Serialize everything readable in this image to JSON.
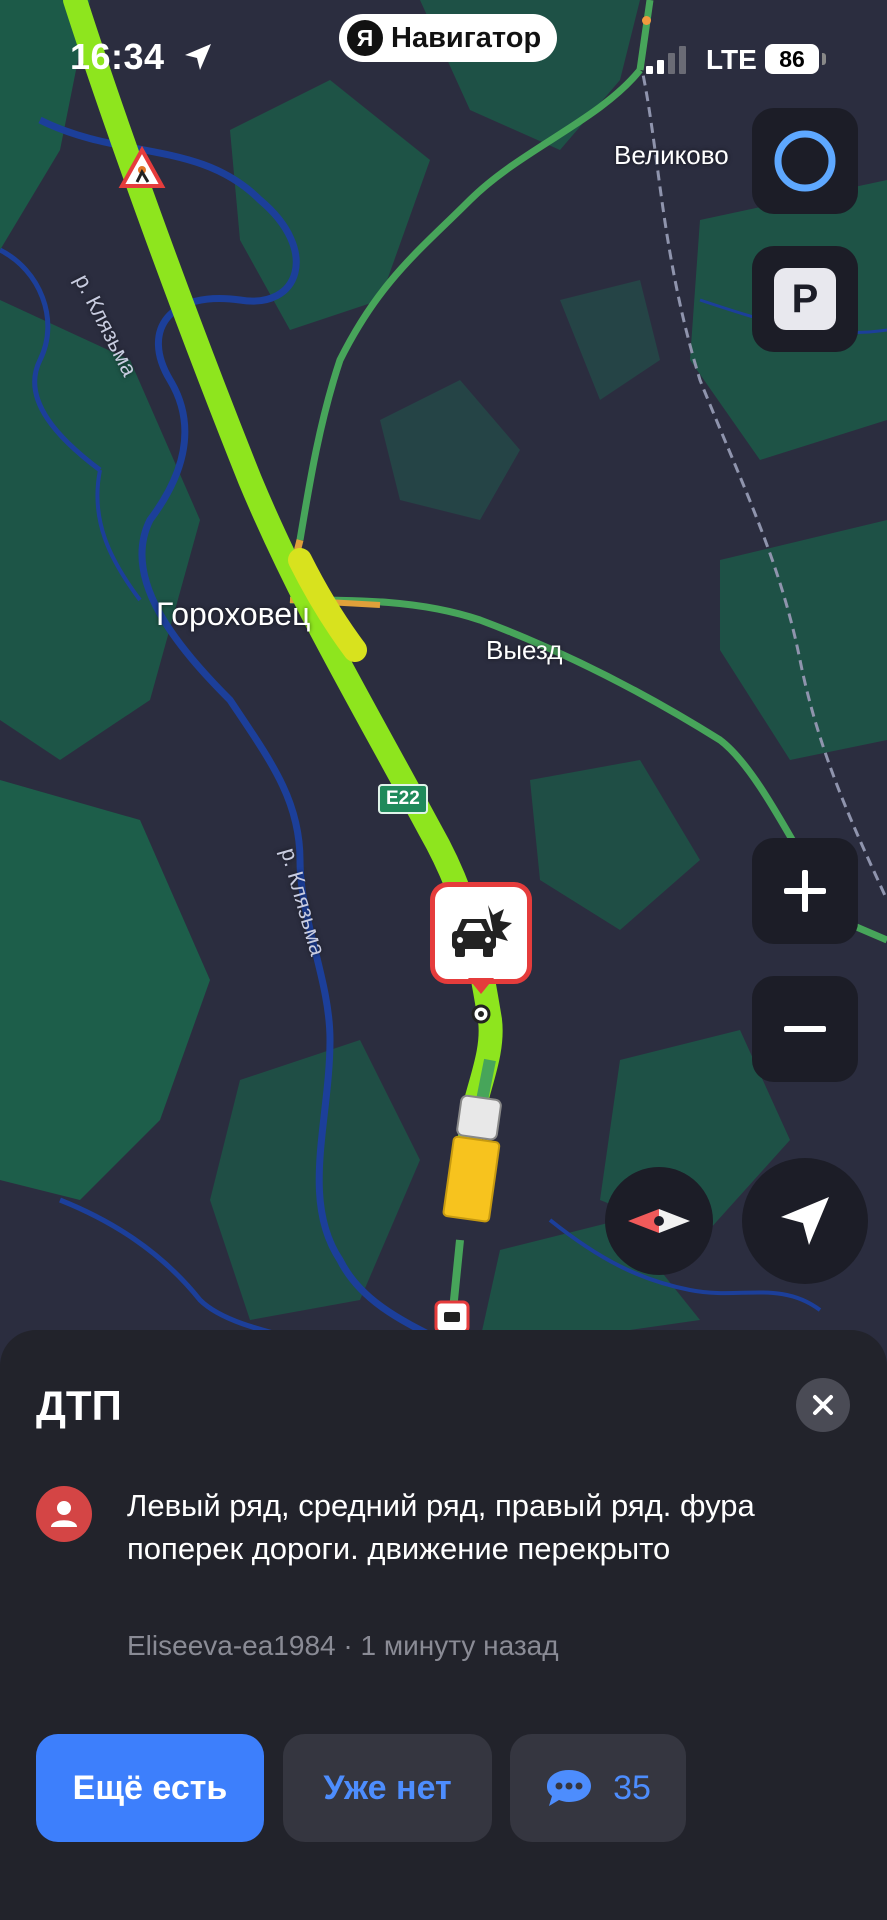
{
  "status_bar": {
    "time": "16:34",
    "network": "LTE",
    "battery": "86"
  },
  "app_pill": {
    "logo": "Я",
    "title": "Навигатор"
  },
  "map": {
    "labels": {
      "velikovo": "Великово",
      "gorohovets": "Гороховец",
      "vyezd": "Выезд",
      "river_1": "р. Клязьма",
      "river_2": "р. Клязьма"
    },
    "road_shield": "E22",
    "colors": {
      "land_dark": "#2b2d3f",
      "forest": "#1c5a48",
      "route_free": "#8ee51e",
      "route_ok": "#47a55a",
      "river": "#1c3f9a",
      "incident_red": "#e53c3c"
    },
    "buttons": {
      "alice": "alice-icon",
      "parking": "P",
      "zoom_in": "+",
      "zoom_out": "−"
    }
  },
  "incident": {
    "title": "ДТП",
    "comment": "Левый ряд, средний ряд, правый ряд. фура поперек дороги. движение перекрыто",
    "author": "Eliseeva-ea1984",
    "separator": "·",
    "time_ago": "1 минуту назад",
    "actions": {
      "still_there": "Ещё есть",
      "gone": "Уже нет",
      "comments_count": "35"
    },
    "accent": "#3d7ffc"
  }
}
